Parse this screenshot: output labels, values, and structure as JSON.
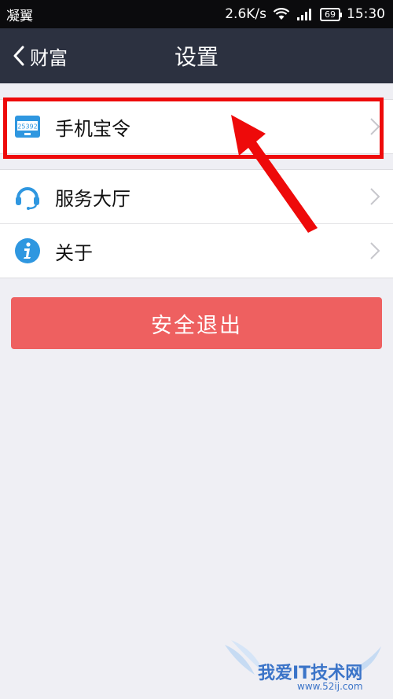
{
  "status_bar": {
    "carrier": "凝翼",
    "speed": "2.6K/s",
    "battery": "69",
    "time": "15:30"
  },
  "nav": {
    "back_label": "财富",
    "title": "设置"
  },
  "menu": {
    "items": [
      {
        "label": "手机宝令",
        "icon": "token-device-icon",
        "icon_text": "25392"
      },
      {
        "label": "服务大厅",
        "icon": "headset-icon"
      },
      {
        "label": "关于",
        "icon": "info-icon"
      }
    ]
  },
  "logout": {
    "label": "安全退出"
  },
  "watermark": {
    "brand": "我爱IT技术网",
    "url": "www.52ij.com"
  },
  "colors": {
    "nav_bg": "#2c3140",
    "page_bg": "#efeff4",
    "logout_bg": "#ee6060",
    "highlight": "#ee0a0a",
    "icon_blue": "#2f97e0"
  }
}
